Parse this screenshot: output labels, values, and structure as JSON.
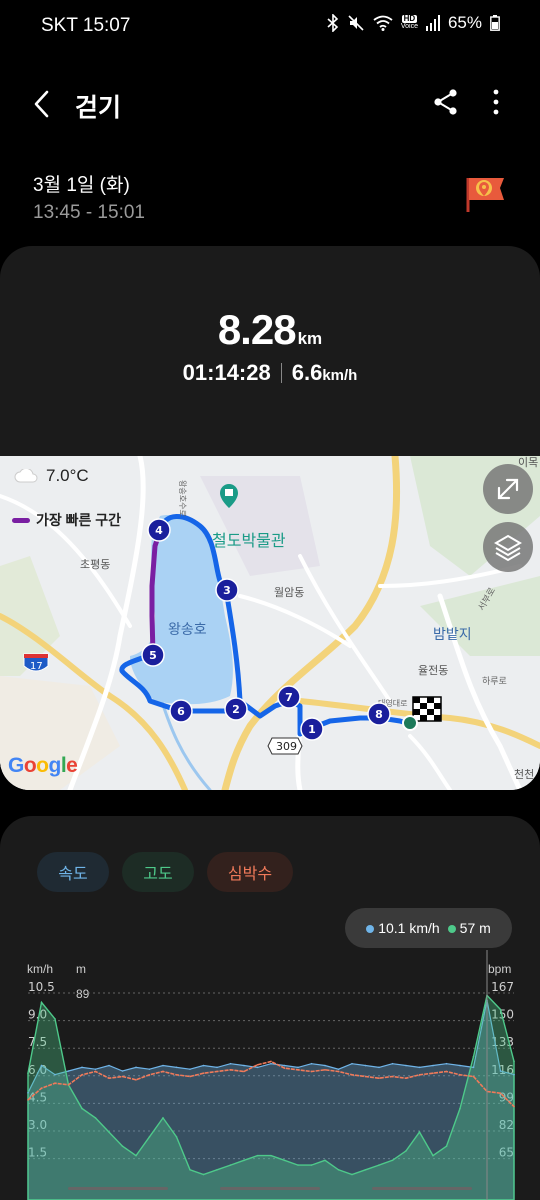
{
  "status": {
    "carrier_time": "SKT 15:07",
    "battery": "65%",
    "hd_label": "HD",
    "voice_label": "Voice"
  },
  "app_bar": {
    "title": "걷기",
    "back_icon": "back-arrow-icon",
    "share_icon": "share-icon",
    "more_icon": "more-vertical-icon"
  },
  "session": {
    "date": "3월 1일 (화)",
    "time_range": "13:45 - 15:01",
    "badge_icon": "location-flag-icon"
  },
  "summary": {
    "distance_value": "8.28",
    "distance_unit": "km",
    "duration": "01:14:28",
    "speed_value": "6.6",
    "speed_unit": "km/h"
  },
  "map": {
    "weather_temp": "7.0°C",
    "fastest_legend": "가장 빠른 구간",
    "labels": {
      "museum": "철도박물관",
      "lake": "왕송호",
      "chopyeong": "초평동",
      "wolam": "월암동",
      "bambatji": "밤밭지",
      "uljeon": "율전동",
      "harureo": "하루로",
      "seobu": "서부로",
      "ium": "이목",
      "cheoncheon": "천천",
      "wangsong_road": "왕송호수로",
      "daeyeong": "대영대로",
      "route_309": "309",
      "route_17": "17"
    },
    "markers": [
      "1",
      "2",
      "3",
      "4",
      "5",
      "6",
      "7",
      "8"
    ],
    "expand_icon": "expand-icon",
    "layers_icon": "layers-icon",
    "google_logo": "Google",
    "route_color": "#1565e8",
    "fastest_color": "#7a1fa2",
    "marker_color": "#1a1f9c"
  },
  "chart": {
    "tabs": [
      {
        "label": "속도",
        "color": "#6fb4e8",
        "bg": "#1f2a33"
      },
      {
        "label": "고도",
        "color": "#4ec98a",
        "bg": "#1d2c25"
      },
      {
        "label": "심박수",
        "color": "#f07a5a",
        "bg": "#33211d"
      }
    ],
    "tooltip": {
      "speed": "10.1 km/h",
      "altitude": "57 m"
    },
    "left_unit_speed": "km/h",
    "left_unit_alt": "m",
    "right_unit": "bpm",
    "speed_ticks": [
      "10.5",
      "9.0",
      "7.5",
      "6.0",
      "4.5",
      "3.0",
      "1.5"
    ],
    "altitude_top_tick": "89",
    "bpm_ticks": [
      "167",
      "150",
      "133",
      "116",
      "99",
      "82",
      "65"
    ]
  },
  "chart_data": {
    "type": "area",
    "title": "",
    "series": [
      {
        "name": "속도",
        "unit": "km/h",
        "color": "#6fb4e8",
        "values": [
          5.0,
          6.5,
          6.0,
          6.2,
          6.4,
          6.3,
          6.5,
          6.2,
          6.4,
          6.3,
          6.5,
          6.4,
          6.3,
          6.5,
          6.4,
          6.6,
          6.5,
          6.4,
          6.6,
          6.5,
          6.4,
          6.6,
          6.5,
          6.3,
          6.6,
          6.5,
          6.4,
          6.6,
          6.5,
          6.4,
          6.5,
          6.6,
          6.5,
          6.4,
          10.1,
          6.2,
          6.0
        ]
      },
      {
        "name": "고도",
        "unit": "m",
        "color": "#4ec98a",
        "values": [
          55,
          85,
          78,
          50,
          40,
          36,
          30,
          24,
          20,
          28,
          36,
          28,
          14,
          12,
          14,
          16,
          18,
          20,
          20,
          18,
          16,
          16,
          18,
          14,
          12,
          14,
          16,
          18,
          22,
          30,
          20,
          24,
          40,
          62,
          88,
          82,
          60
        ]
      },
      {
        "name": "심박수",
        "unit": "bpm",
        "color": "#f07a5a",
        "values": [
          103,
          110,
          113,
          112,
          118,
          120,
          116,
          117,
          115,
          118,
          120,
          118,
          117,
          119,
          120,
          121,
          120,
          124,
          126,
          122,
          121,
          120,
          121,
          120,
          118,
          117,
          116,
          117,
          116,
          118,
          119,
          120,
          118,
          117,
          108,
          107,
          99
        ]
      }
    ],
    "y_left_speed": [
      0,
      10.5
    ],
    "y_left_altitude_max": 89,
    "y_right": [
      48,
      167
    ],
    "grid": true,
    "legend": "top"
  }
}
